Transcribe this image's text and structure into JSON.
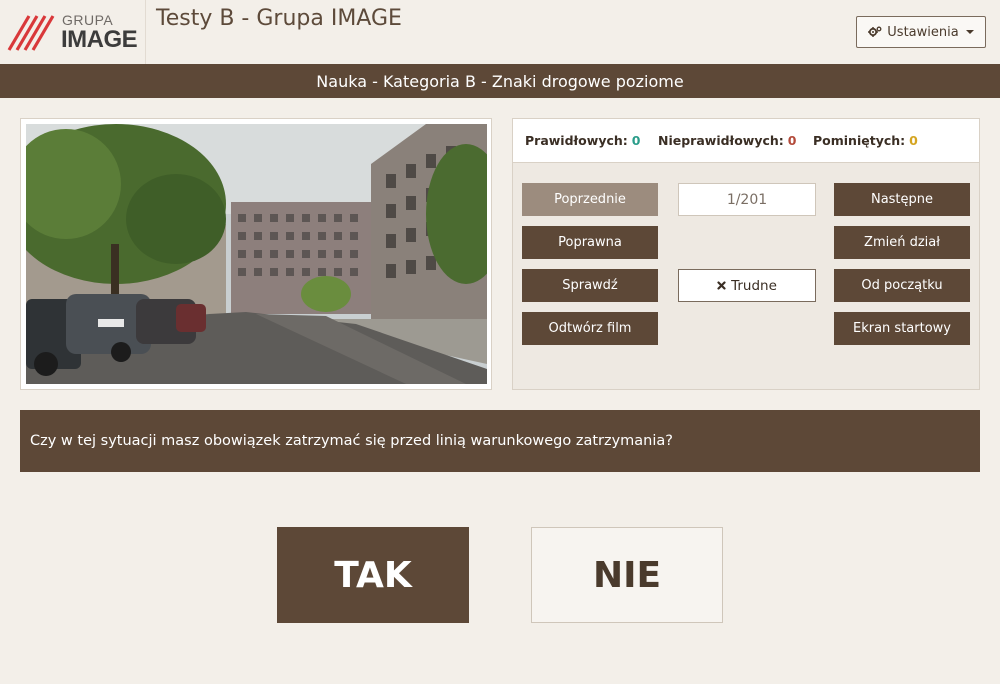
{
  "header": {
    "logo_small": "GRUPA",
    "logo_big": "IMAGE",
    "title": "Testy B - Grupa IMAGE",
    "settings_label": "Ustawienia"
  },
  "category_bar": "Nauka - Kategoria B - Znaki drogowe poziome",
  "stats": {
    "correct_label": "Prawidłowych:",
    "correct_value": "0",
    "wrong_label": "Nieprawidłowych:",
    "wrong_value": "0",
    "skipped_label": "Pominiętych:",
    "skipped_value": "0"
  },
  "controls": {
    "previous": "Poprzednie",
    "counter": "1/201",
    "next": "Następne",
    "correct": "Poprawna",
    "change_section": "Zmień dział",
    "check": "Sprawdź",
    "hard": "Trudne",
    "from_start": "Od początku",
    "play_video": "Odtwórz film",
    "start_screen": "Ekran startowy"
  },
  "question": "Czy w tej sytuacji masz obowiązek zatrzymać się przed linią warunkowego zatrzymania?",
  "answers": {
    "yes": "TAK",
    "no": "NIE"
  },
  "colors": {
    "brand_brown": "#5d4837",
    "correct": "#2a9d8a",
    "wrong": "#b34a3a",
    "skipped": "#d5a521",
    "logo_red": "#d9383a"
  },
  "icons": {
    "settings": "gears-icon",
    "hard": "times-icon",
    "dropdown": "caret-down-icon"
  }
}
